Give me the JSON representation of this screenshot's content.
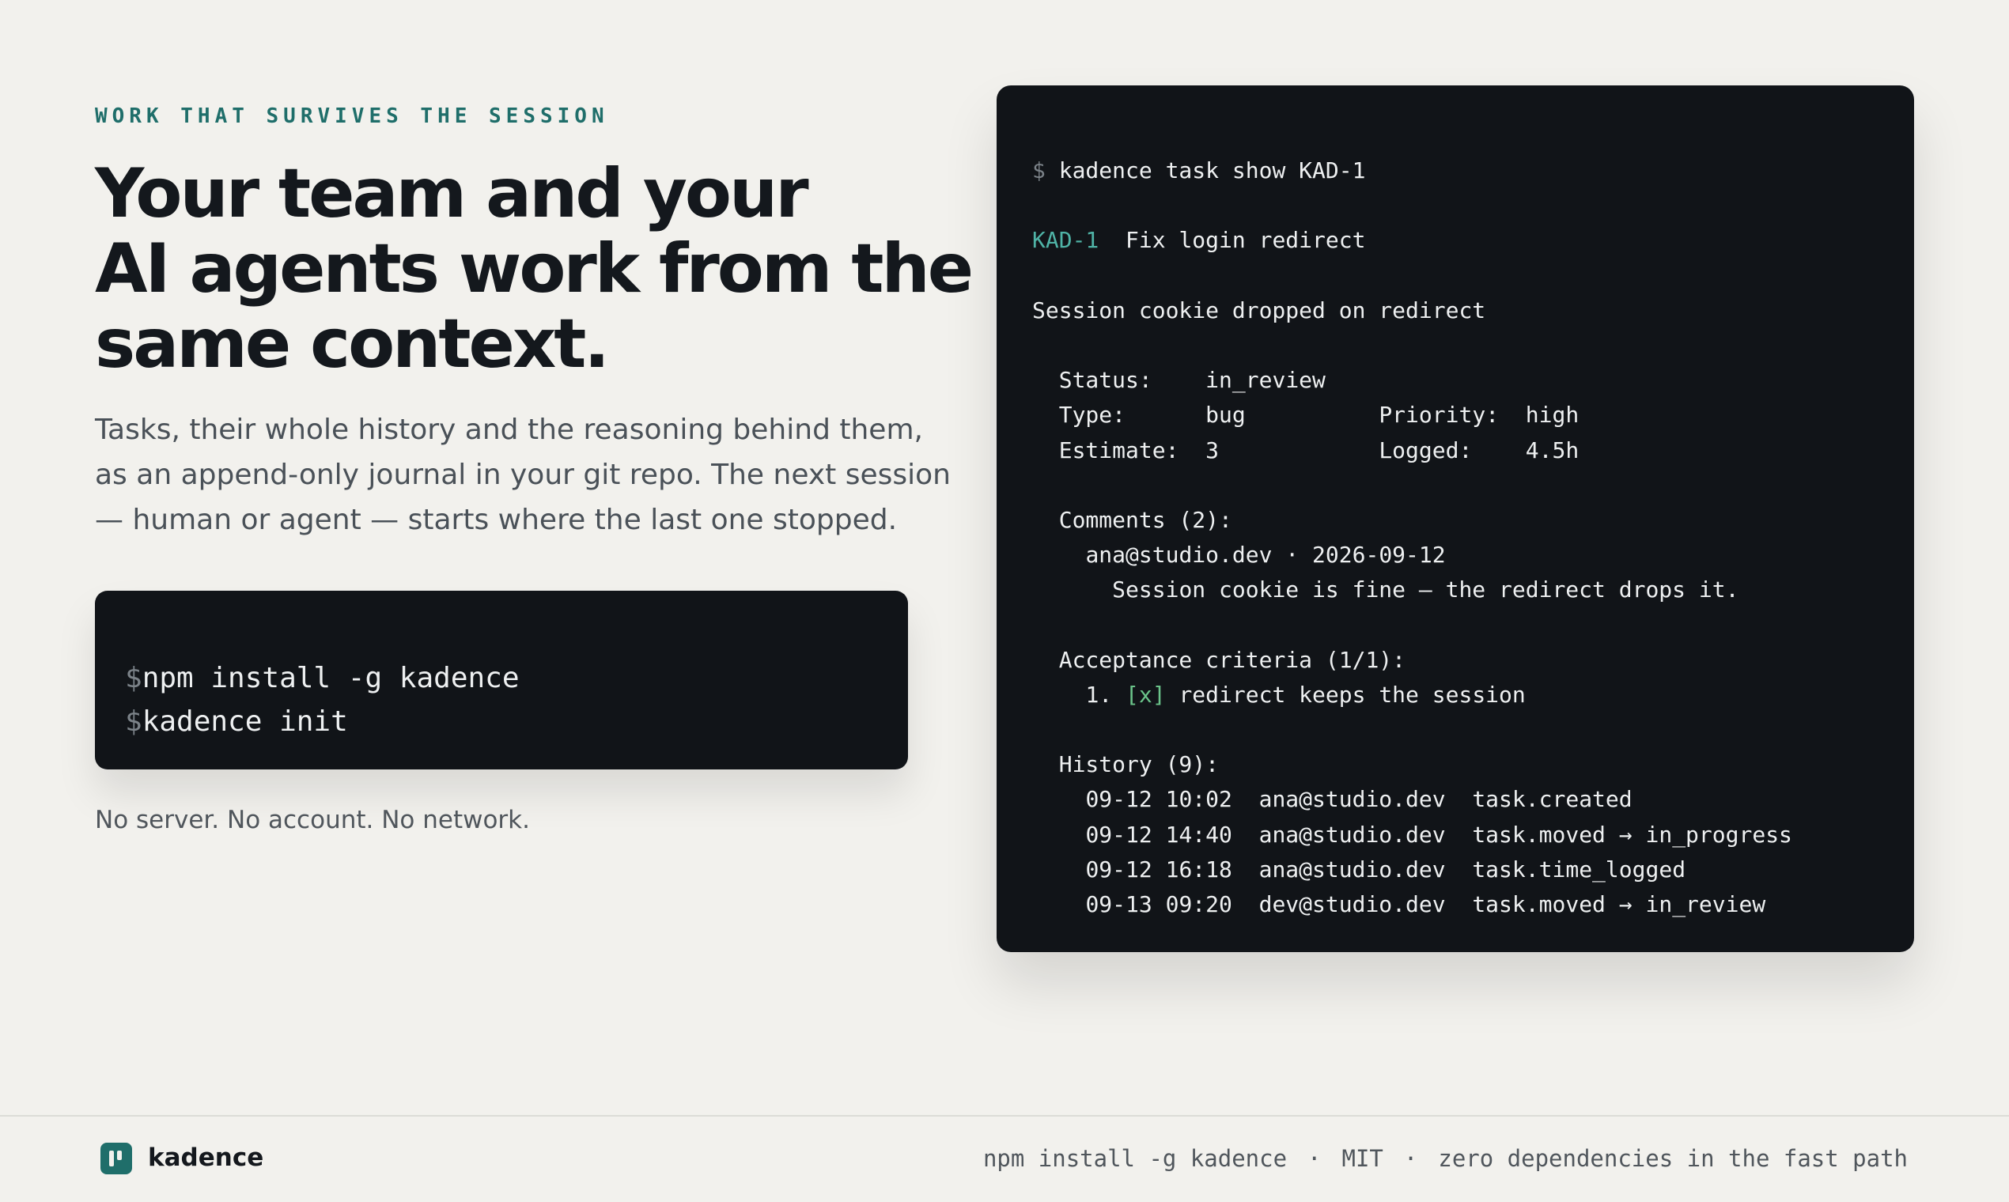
{
  "hero": {
    "eyebrow": "WORK THAT SURVIVES THE SESSION",
    "headline_lines": [
      "Your team and your",
      "AI agents work from the",
      "same context."
    ],
    "lede_lines": [
      "Tasks, their whole history and the reasoning behind them,",
      "as an append-only journal in your git repo. The next session",
      "— human or agent — starts where the last one stopped."
    ],
    "install_commands": [
      "npm install -g kadence",
      "kadence init"
    ],
    "prompt_symbol": "$",
    "note": "No server. No account. No network."
  },
  "terminal": {
    "command": "kadence task show KAD-1",
    "task_id": "KAD-1",
    "task_title": "Fix login redirect",
    "summary": "Session cookie dropped on redirect",
    "fields": {
      "status_label": "Status:",
      "status_value": "in_review",
      "type_label": "Type:",
      "type_value": "bug",
      "priority_label": "Priority:",
      "priority_value": "high",
      "estimate_label": "Estimate:",
      "estimate_value": "3",
      "logged_label": "Logged:",
      "logged_value": "4.5h"
    },
    "comments_heading": "Comments (2):",
    "comment": {
      "author": "ana@studio.dev",
      "date": "2026-09-12",
      "body": "Session cookie is fine — the redirect drops it."
    },
    "criteria_heading": "Acceptance criteria (1/1):",
    "criteria": [
      {
        "index": "1.",
        "check": "[x]",
        "text": "redirect keeps the session"
      }
    ],
    "history_heading": "History (9):",
    "history": [
      {
        "time": "09-12 10:02",
        "author": "ana@studio.dev",
        "event": "task.created"
      },
      {
        "time": "09-12 14:40",
        "author": "ana@studio.dev",
        "event": "task.moved → in_progress"
      },
      {
        "time": "09-12 16:18",
        "author": "ana@studio.dev",
        "event": "task.time_logged"
      },
      {
        "time": "09-13 09:20",
        "author": "dev@studio.dev",
        "event": "task.moved → in_review"
      }
    ]
  },
  "footer": {
    "brand": "kadence",
    "install": "npm install -g kadence",
    "license": "MIT",
    "tagline": "zero dependencies in the fast path",
    "separator": "·"
  },
  "colors": {
    "background": "#f2f1ed",
    "accent": "#1f6e6a",
    "terminal_bg": "#111418",
    "terminal_accent": "#4fb3a6",
    "check_green": "#6bc48a"
  }
}
